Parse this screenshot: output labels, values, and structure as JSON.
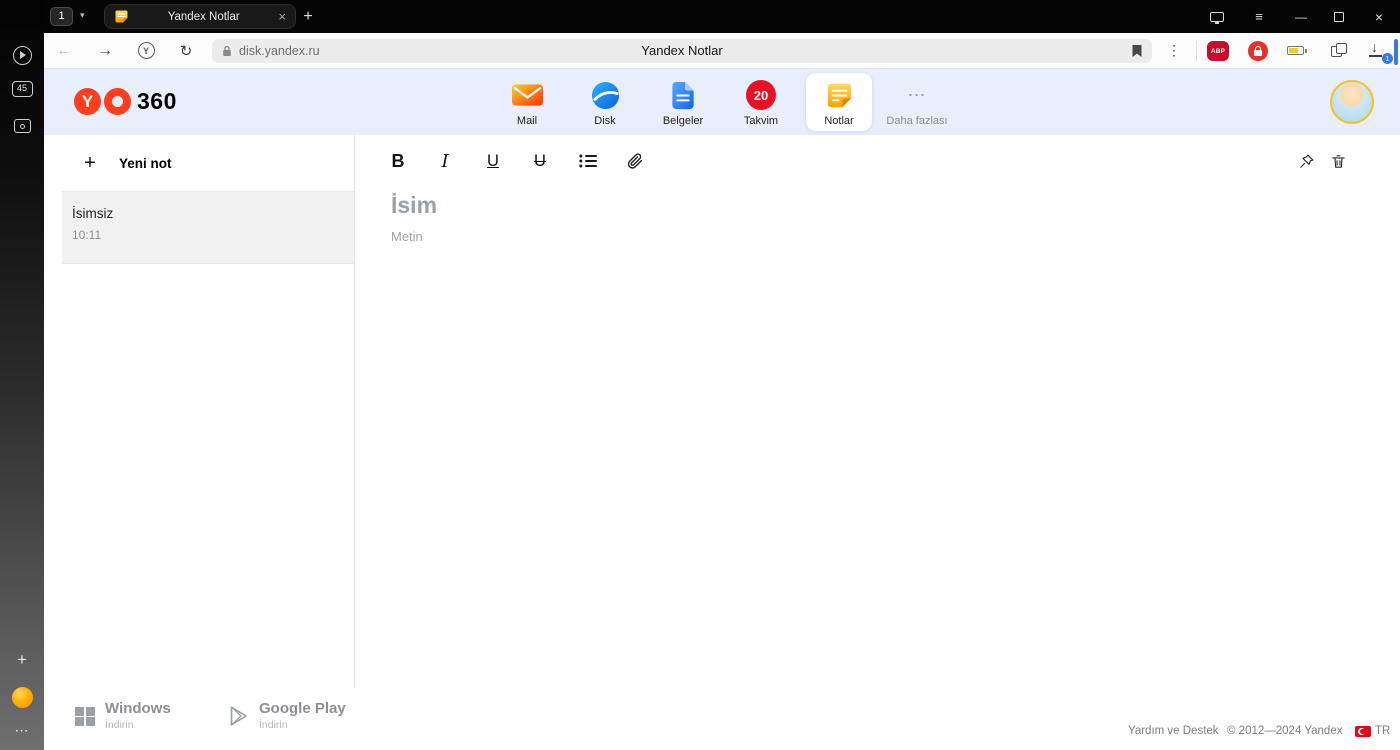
{
  "browser": {
    "sidebar_tab_count": "45",
    "tab_group_count": "1",
    "tab_title": "Yandex Notlar",
    "url": "disk.yandex.ru",
    "page_title": "Yandex Notlar",
    "download_badge": "1",
    "abp_label": "ABP",
    "yandex_button_letter": "Y"
  },
  "app_header": {
    "logo_letter": "Y",
    "logo_text": "360",
    "apps": [
      {
        "label": "Mail"
      },
      {
        "label": "Disk"
      },
      {
        "label": "Belgeler"
      },
      {
        "label": "Takvim",
        "badge": "20"
      },
      {
        "label": "Notlar"
      },
      {
        "label": "Daha fazlası"
      }
    ]
  },
  "notes_panel": {
    "new_note_label": "Yeni not",
    "items": [
      {
        "title": "İsimsiz",
        "time": "10:11"
      }
    ]
  },
  "editor": {
    "title_placeholder": "İsim",
    "body_placeholder": "Metin",
    "toolbar": {
      "bold": "B",
      "italic": "I",
      "underline": "U",
      "strikethrough": "U"
    }
  },
  "footer": {
    "windows_label": "Windows",
    "windows_sub": "İndirin",
    "gplay_label": "Google Play",
    "gplay_sub": "İndirin",
    "help": "Yardım ve Destek",
    "copyright": "© 2012—2024 Yandex",
    "lang": "TR"
  },
  "icons": {
    "back": "←",
    "forward": "→",
    "reload": "↻",
    "plus": "+",
    "new_tab": "+",
    "chevron_down": "▾",
    "kebab": "⋮",
    "menu": "≡",
    "minimize": "—",
    "close": "×",
    "more": "⋯",
    "download_arrow": "↓"
  },
  "colors": {
    "accent_red": "#fc3f1d",
    "header_bg": "#e8eefb",
    "badge_blue": "#2f7cf6",
    "calendar_red": "#e81123"
  }
}
